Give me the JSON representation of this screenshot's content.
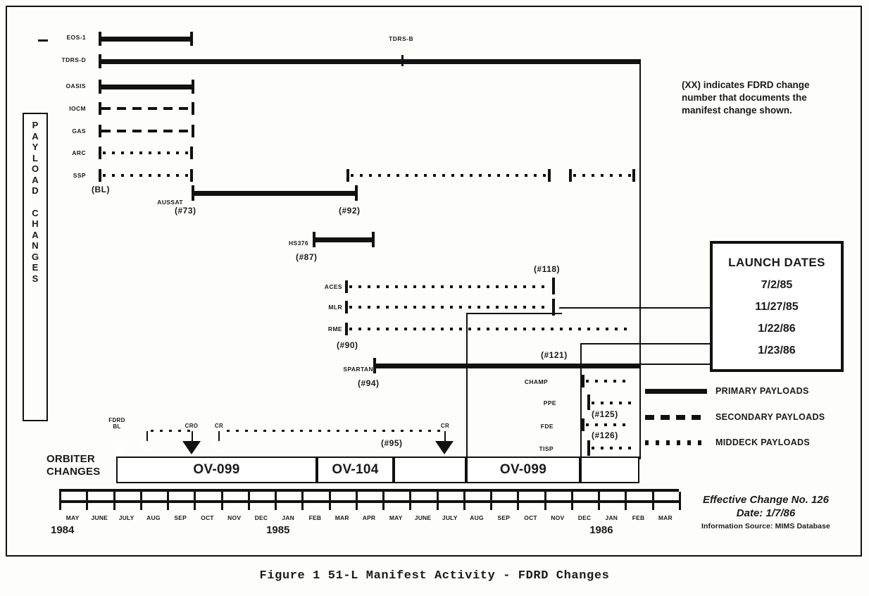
{
  "figure": {
    "caption": "Figure 1 51-L Manifest Activity - FDRD Changes"
  },
  "side_label": {
    "line1": "PAYLOAD",
    "line2": "CHANGES"
  },
  "note": {
    "text": "(XX) indicates FDRD change number that documents the manifest change shown."
  },
  "launch_dates": {
    "title": "LAUNCH DATES",
    "dates": [
      "7/2/85",
      "11/27/85",
      "1/22/86",
      "1/23/86"
    ]
  },
  "legend": {
    "items": [
      {
        "label": "PRIMARY PAYLOADS",
        "style": "solid"
      },
      {
        "label": "SECONDARY PAYLOADS",
        "style": "dashed"
      },
      {
        "label": "MIDDECK PAYLOADS",
        "style": "dotted"
      }
    ]
  },
  "orbiter": {
    "title_line1": "ORBITER",
    "title_line2": "CHANGES",
    "bands": [
      {
        "name": "OV-099"
      },
      {
        "name": "OV-104"
      },
      {
        "name": ""
      },
      {
        "name": "OV-099"
      },
      {
        "name": ""
      }
    ],
    "markers": [
      {
        "label": "FDRD\nBL",
        "type": "open"
      },
      {
        "label": "",
        "type": "open"
      },
      {
        "label": "CRO",
        "type": "filled"
      },
      {
        "label": "CR",
        "type": "open"
      },
      {
        "label": "CR",
        "type": "filled"
      }
    ],
    "marker_change": "(#95)"
  },
  "timeline": {
    "months": [
      "MAY",
      "JUNE",
      "JULY",
      "AUG",
      "SEP",
      "OCT",
      "NOV",
      "DEC",
      "JAN",
      "FEB",
      "MAR",
      "APR",
      "MAY",
      "JUNE",
      "JULY",
      "AUG",
      "SEP",
      "OCT",
      "NOV",
      "DEC",
      "JAN",
      "FEB",
      "MAR"
    ],
    "years": [
      {
        "label": "1984",
        "month_index": 0
      },
      {
        "label": "1985",
        "month_index": 8
      },
      {
        "label": "1986",
        "month_index": 20
      }
    ]
  },
  "payload_rows": [
    {
      "name": "EOS-1",
      "style": "solid"
    },
    {
      "name": "TDRS-D",
      "style": "solid"
    },
    {
      "name": "OASIS",
      "style": "solid"
    },
    {
      "name": "IOCM",
      "style": "dashed"
    },
    {
      "name": "GAS",
      "style": "dashed"
    },
    {
      "name": "ARC",
      "style": "dotted"
    },
    {
      "name": "SSP",
      "style": "dotted"
    },
    {
      "name": "AUSSAT",
      "style": "solid"
    },
    {
      "name": "HS376",
      "style": "solid"
    },
    {
      "name": "ACES",
      "style": "dotted"
    },
    {
      "name": "MLR",
      "style": "dotted"
    },
    {
      "name": "RME",
      "style": "dotted"
    },
    {
      "name": "SPARTAN",
      "style": "solid"
    },
    {
      "name": "CHAMP",
      "style": "dotted"
    },
    {
      "name": "PPE",
      "style": "dotted"
    },
    {
      "name": "FDE",
      "style": "dotted"
    },
    {
      "name": "TISP",
      "style": "dotted"
    }
  ],
  "annotations": {
    "tdrs_b": "TDRS-B",
    "baseline": "(BL)",
    "aussat_start": "(#73)",
    "aussat_end": "(#92)",
    "hs376": "(#87)",
    "aces_end": "(#118)",
    "rme_start": "(#90)",
    "spartan_start": "(#94)",
    "spartan_change": "(#121)",
    "ppe_change": "(#125)",
    "tisp_change": "(#126)"
  },
  "credits": {
    "line1": "Effective Change No. 126",
    "line2": "Date: 1/7/86",
    "line3": "Information Source: MIMS Database"
  }
}
